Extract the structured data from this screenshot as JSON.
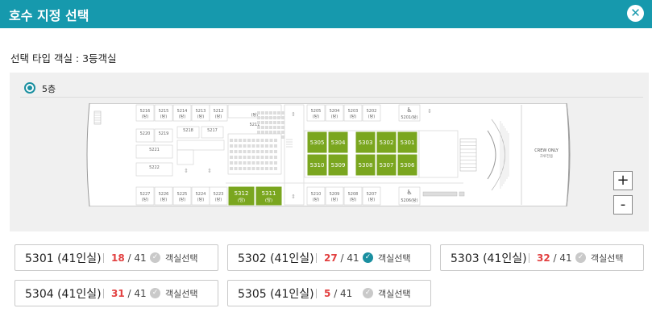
{
  "header": {
    "title": "호수 지정 선택",
    "close_icon": "close-icon"
  },
  "subtitle": "선택 타입 객실 : 3등객실",
  "floor": {
    "label": "5층",
    "selected": true
  },
  "map": {
    "top_rooms": [
      {
        "no": "5216",
        "tag": "(탕)"
      },
      {
        "no": "5215",
        "tag": "(탕)"
      },
      {
        "no": "5214",
        "tag": "(탕)"
      },
      {
        "no": "5213",
        "tag": "(탕)"
      },
      {
        "no": "5212",
        "tag": "(탕)"
      }
    ],
    "top_mid": {
      "no": "5211",
      "tag": "(탕)"
    },
    "top_right": [
      {
        "no": "5205",
        "tag": "(탕)"
      },
      {
        "no": "5204",
        "tag": "(탕)"
      },
      {
        "no": "5203",
        "tag": "(탕)"
      },
      {
        "no": "5202",
        "tag": "(탕)"
      }
    ],
    "top_accessible": "5201(탕)",
    "mid_rooms": [
      "5220",
      "5219",
      "5218",
      "5217",
      "5221",
      "5222"
    ],
    "bottom_rooms": [
      {
        "no": "5227",
        "tag": "(탕)"
      },
      {
        "no": "5226",
        "tag": "(탕)"
      },
      {
        "no": "5225",
        "tag": "(탕)"
      },
      {
        "no": "5224",
        "tag": "(탕)"
      },
      {
        "no": "5223",
        "tag": "(탕)"
      }
    ],
    "bottom_green": [
      "5312",
      "5311"
    ],
    "bottom_green_tag": "(탕)",
    "bottom_right": [
      {
        "no": "5210",
        "tag": "(탕)"
      },
      {
        "no": "5209",
        "tag": "(탕)"
      },
      {
        "no": "5208",
        "tag": "(탕)"
      },
      {
        "no": "5207",
        "tag": "(탕)"
      }
    ],
    "bottom_accessible": "5206(탕)",
    "center_row1": [
      "5305",
      "5304",
      "5303",
      "5302",
      "5301"
    ],
    "center_row2": [
      "5310",
      "5309",
      "5308",
      "5307",
      "5306"
    ],
    "crew": [
      "CREW ONLY",
      "크루전용"
    ],
    "accent_green": "#7aa61f",
    "accessible_icon": "wheelchair-icon"
  },
  "zoom": {
    "in": "+",
    "out": "-"
  },
  "rooms": [
    {
      "name": "5301 (41인실)",
      "count": "18",
      "total": "/ 41",
      "action": "객실선택",
      "selected": false
    },
    {
      "name": "5302 (41인실)",
      "count": "27",
      "total": "/ 41",
      "action": "객실선택",
      "selected": true
    },
    {
      "name": "5303 (41인실)",
      "count": "32",
      "total": "/ 41",
      "action": "객실선택",
      "selected": false
    },
    {
      "name": "5304 (41인실)",
      "count": "31",
      "total": "/ 41",
      "action": "객실선택",
      "selected": false
    },
    {
      "name": "5305 (41인실)",
      "count": "5",
      "total": "/ 41",
      "action": "객실선택",
      "selected": false
    }
  ]
}
